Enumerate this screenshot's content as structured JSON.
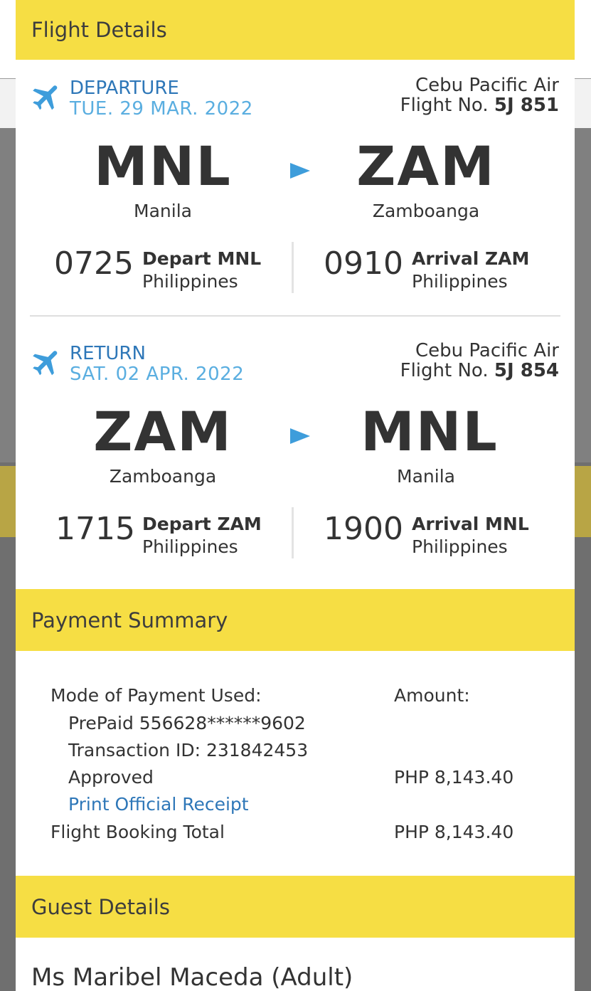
{
  "flight_details": {
    "title": "Flight Details",
    "departure": {
      "direction": "DEPARTURE",
      "date": "TUE. 29 MAR. 2022",
      "airline": "Cebu Pacific Air",
      "flight_no_label": "Flight No.",
      "flight_no": "5J 851",
      "origin_code": "MNL",
      "origin_city": "Manila",
      "dest_code": "ZAM",
      "dest_city": "Zamboanga",
      "depart_time": "0725",
      "depart_label": "Depart MNL",
      "depart_country": "Philippines",
      "arrive_time": "0910",
      "arrive_label": "Arrival ZAM",
      "arrive_country": "Philippines"
    },
    "return": {
      "direction": "RETURN",
      "date": "SAT. 02 APR. 2022",
      "airline": "Cebu Pacific Air",
      "flight_no_label": "Flight No.",
      "flight_no": "5J 854",
      "origin_code": "ZAM",
      "origin_city": "Zamboanga",
      "dest_code": "MNL",
      "dest_city": "Manila",
      "depart_time": "1715",
      "depart_label": "Depart ZAM",
      "depart_country": "Philippines",
      "arrive_time": "1900",
      "arrive_label": "Arrival MNL",
      "arrive_country": "Philippines"
    }
  },
  "payment_summary": {
    "title": "Payment Summary",
    "mode_label": "Mode of Payment Used:",
    "amount_label": "Amount:",
    "method": "PrePaid 556628******9602",
    "transaction": "Transaction ID: 231842453",
    "status": "Approved",
    "status_amount": "PHP 8,143.40",
    "receipt_link": "Print Official Receipt",
    "total_label": "Flight Booking Total",
    "total_amount": "PHP 8,143.40"
  },
  "guest_details": {
    "title": "Guest Details",
    "guest_name": "Ms Maribel Maceda (Adult)"
  },
  "colors": {
    "section_header": "#f6de44",
    "direction_text": "#2e77b8",
    "date_text": "#5aaee0",
    "arrow": "#3e9ddb",
    "link": "#2e77b8"
  },
  "icons": [
    "airplane-icon",
    "arrow-right-icon"
  ]
}
